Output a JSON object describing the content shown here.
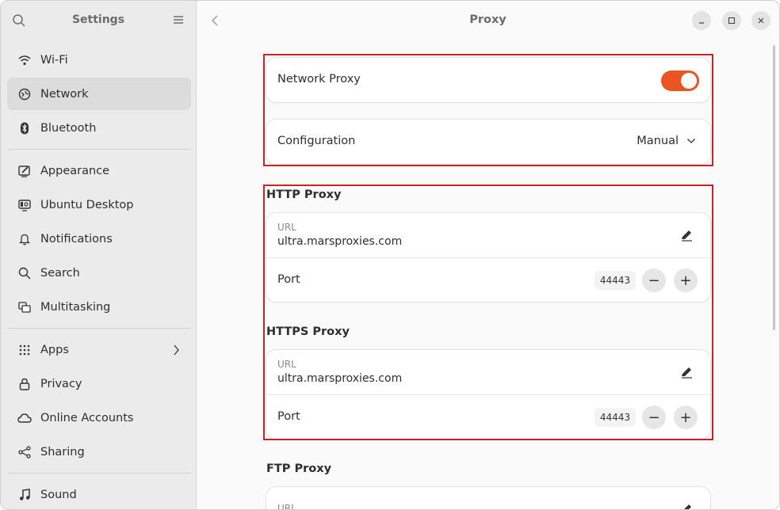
{
  "sidebar": {
    "title": "Settings",
    "items": [
      {
        "label": "Wi-Fi",
        "icon": "wifi-icon"
      },
      {
        "label": "Network",
        "icon": "network-icon"
      },
      {
        "label": "Bluetooth",
        "icon": "bluetooth-icon"
      },
      {
        "label": "Appearance",
        "icon": "appearance-icon"
      },
      {
        "label": "Ubuntu Desktop",
        "icon": "ubuntu-desktop-icon"
      },
      {
        "label": "Notifications",
        "icon": "bell-icon"
      },
      {
        "label": "Search",
        "icon": "search-icon"
      },
      {
        "label": "Multitasking",
        "icon": "multitasking-icon"
      },
      {
        "label": "Apps",
        "icon": "apps-grid-icon"
      },
      {
        "label": "Privacy",
        "icon": "lock-icon"
      },
      {
        "label": "Online Accounts",
        "icon": "cloud-icon"
      },
      {
        "label": "Sharing",
        "icon": "share-icon"
      },
      {
        "label": "Sound",
        "icon": "music-note-icon"
      }
    ],
    "active": "Network"
  },
  "main": {
    "title": "Proxy",
    "network_proxy": {
      "label": "Network Proxy",
      "enabled": true
    },
    "configuration": {
      "label": "Configuration",
      "value": "Manual"
    },
    "http": {
      "title": "HTTP Proxy",
      "url_label": "URL",
      "url_value": "ultra.marsproxies.com",
      "port_label": "Port",
      "port_value": "44443"
    },
    "https": {
      "title": "HTTPS Proxy",
      "url_label": "URL",
      "url_value": "ultra.marsproxies.com",
      "port_label": "Port",
      "port_value": "44443"
    },
    "ftp": {
      "title": "FTP Proxy",
      "url_label": "URL"
    }
  },
  "colors": {
    "accent": "#e95420",
    "highlight": "#cc2027"
  }
}
